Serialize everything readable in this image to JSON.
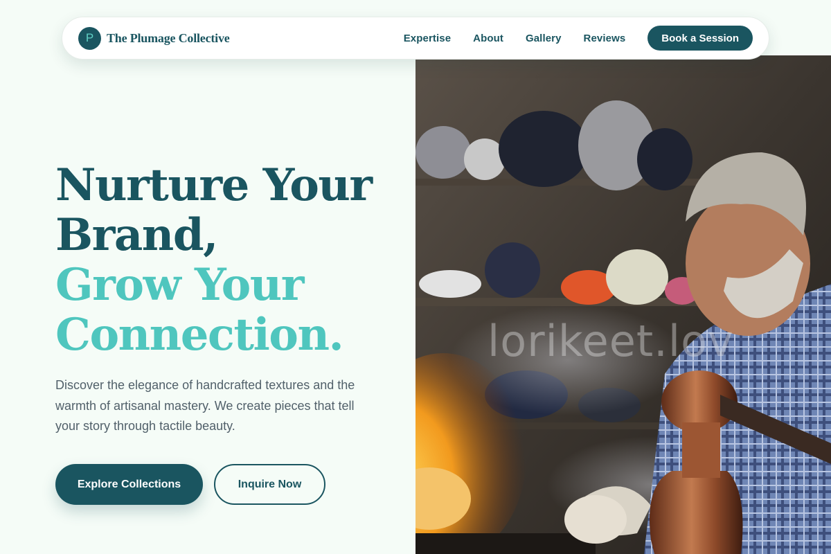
{
  "nav": {
    "logo_letter": "P",
    "brand_name": "The Plumage Collective",
    "links": [
      {
        "label": "Expertise"
      },
      {
        "label": "About"
      },
      {
        "label": "Gallery"
      },
      {
        "label": "Reviews"
      }
    ],
    "cta_label": "Book a Session"
  },
  "hero": {
    "headline_line1": "Nurture Your",
    "headline_line2": "Brand,",
    "headline_line3": "Grow Your",
    "headline_line4": "Connection.",
    "description": "Discover the elegance of handcrafted textures and the warmth of artisanal mastery. We create pieces that tell your story through tactile beauty.",
    "primary_button": "Explore Collections",
    "secondary_button": "Inquire Now"
  },
  "image": {
    "watermark_text": "lorikeet.lov"
  },
  "colors": {
    "primary": "#1a5560",
    "accent": "#4fc6be",
    "background": "#f5fcf7",
    "body_text": "#51606a"
  }
}
